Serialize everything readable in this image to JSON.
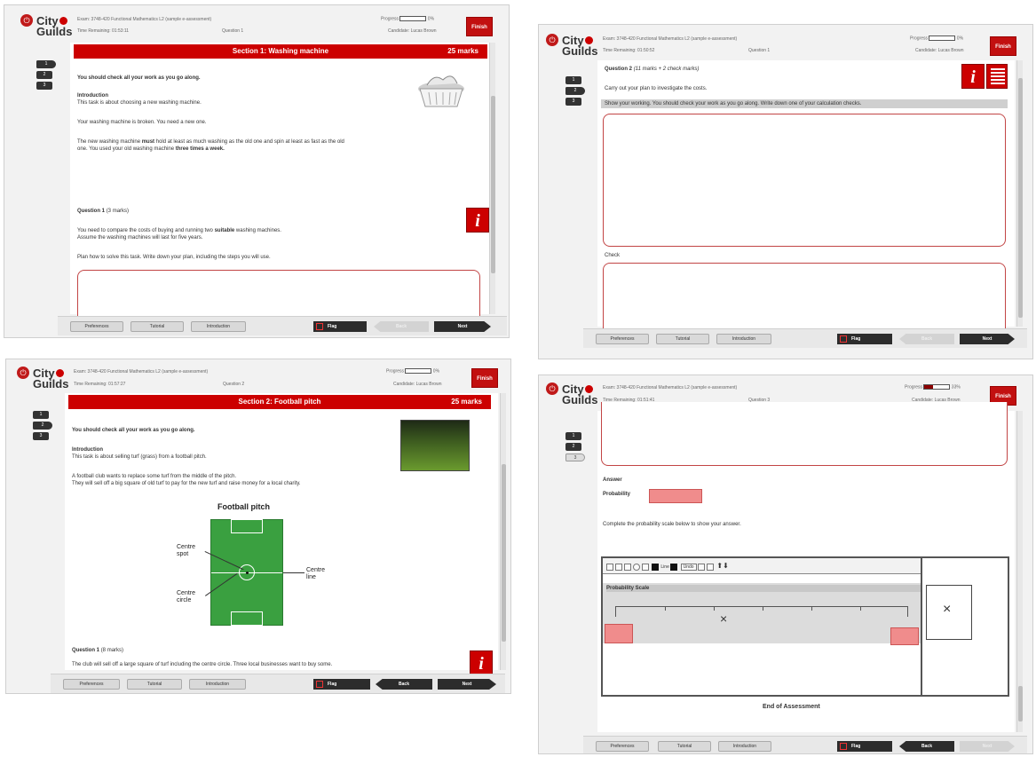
{
  "common": {
    "logo_top": "City",
    "logo_bottom": "Guilds",
    "exam": "Exam: 3748-420 Functional Mathematics L2 (sample e-assessment)",
    "time_label": "Time Remaining:",
    "progress_label": "Progress",
    "candidate": "Candidate: Lucas Brown",
    "finish": "Finish",
    "preferences": "Preferences",
    "tutorial": "Tutorial",
    "introduction": "Introduction",
    "flag": "Flag",
    "back": "Back",
    "next": "Next"
  },
  "panel1": {
    "time": "01:53:11",
    "question": "Question 1",
    "progress_pct": "0%",
    "progress_fraction": 0,
    "nav": [
      "1",
      "2",
      "3"
    ],
    "banner_title": "Section 1: Washing machine",
    "banner_marks": "25 marks",
    "check": "You should check all your work as you go along.",
    "intro_heading": "Introduction",
    "intro_1": "This task is about choosing a new washing machine.",
    "intro_2": "Your washing machine is broken. You need a new one.",
    "intro_3a": "The new washing machine",
    "intro_3_must": "must",
    "intro_3b": "hold at least as much washing as the old one and spin at least as fast as the old",
    "intro_3c": "one. You used your old washing machine",
    "intro_3_times": "three times a week.",
    "q_heading": "Question 1",
    "q_marks": "(3 marks)",
    "q_text1a": "You need to compare the costs of buying and running two",
    "q_text1_bold": "suitable",
    "q_text1b": "washing machines.",
    "q_text2": "Assume the washing machines will last for five years.",
    "q_text3": "Plan how to solve this task. Write down your plan, including the steps you will use."
  },
  "panel2": {
    "time": "01:50:52",
    "question": "Question 1",
    "progress_pct": "0%",
    "progress_fraction": 0,
    "nav": [
      "1",
      "2",
      "3"
    ],
    "q_heading": "Question 2",
    "q_marks": "(11 marks + 2 check marks)",
    "instruction": "Carry out your plan to investigate the costs.",
    "highlight": "Show your working. You should check your work as you go along. Write down one of your calculation checks.",
    "check_label": "Check"
  },
  "panel3": {
    "time": "01:57:27",
    "question": "Question 2",
    "progress_pct": "0%",
    "progress_fraction": 0,
    "nav": [
      "1",
      "2",
      "3"
    ],
    "banner_title": "Section 2: Football pitch",
    "banner_marks": "25 marks",
    "check": "You should check all your work as you go along.",
    "intro_heading": "Introduction",
    "intro_1": "This task is about selling turf (grass) from a football pitch.",
    "intro_2": "A football club wants to replace some turf from the middle of the pitch.",
    "intro_3": "They will sell off a big square of old turf to pay for the new turf and raise money for a local charity.",
    "diagram_title": "Football pitch",
    "label_spot": "Centre spot",
    "label_circle": "Centre circle",
    "label_line": "Centre line",
    "q_heading": "Question 1",
    "q_marks": "(8 marks)",
    "q_text": "The club will sell off a large square of turf including the centre circle. Three local businesses want to buy some."
  },
  "panel4": {
    "time": "01:51:41",
    "question": "Question 3",
    "progress_pct": "33%",
    "progress_fraction": 0.33,
    "nav": [
      "1",
      "2",
      "3"
    ],
    "answer": "Answer",
    "probability": "Probability",
    "complete": "Complete the probability scale below to show your answer.",
    "toolbar_line": "Line",
    "toolbar_undo": "Undo",
    "scale_title": "Probability Scale",
    "x_mark": "×",
    "end": "End of Assessment"
  },
  "colors": {
    "brand_red": "#cc0000",
    "dark_button": "#2c2c2c"
  }
}
